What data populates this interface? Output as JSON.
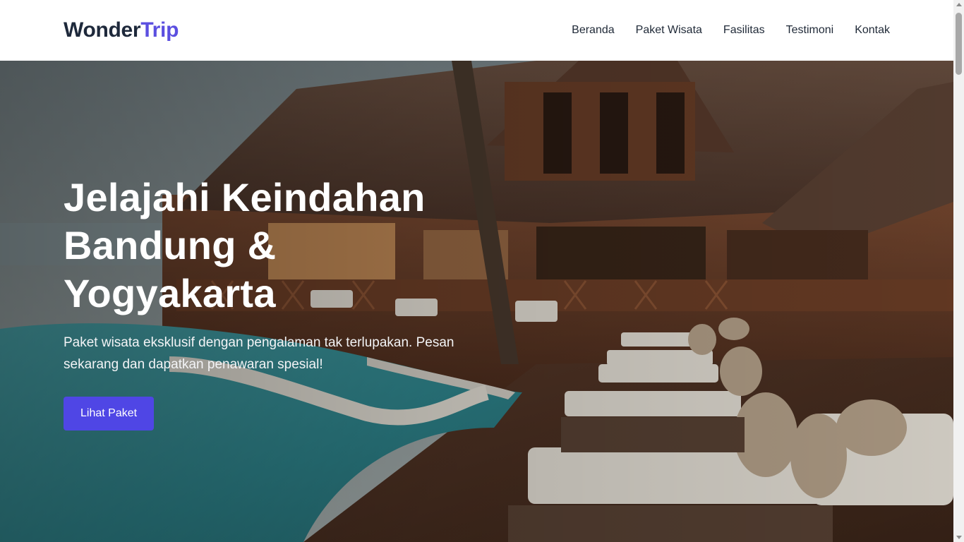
{
  "brand": {
    "name_part1": "Wonder",
    "name_part2": "Trip",
    "accent_color": "#5b4fe0"
  },
  "nav": {
    "items": [
      {
        "label": "Beranda"
      },
      {
        "label": "Paket Wisata"
      },
      {
        "label": "Fasilitas"
      },
      {
        "label": "Testimoni"
      },
      {
        "label": "Kontak"
      }
    ]
  },
  "hero": {
    "title_line1": "Jelajahi Keindahan",
    "title_line2": "Bandung &",
    "title_line3": "Yogyakarta",
    "subtitle": "Paket wisata eksklusif dengan pengalaman tak terlupakan. Pesan sekarang dan dapatkan penawaran spesial!",
    "cta_label": "Lihat Paket",
    "cta_color": "#4f46e5"
  }
}
